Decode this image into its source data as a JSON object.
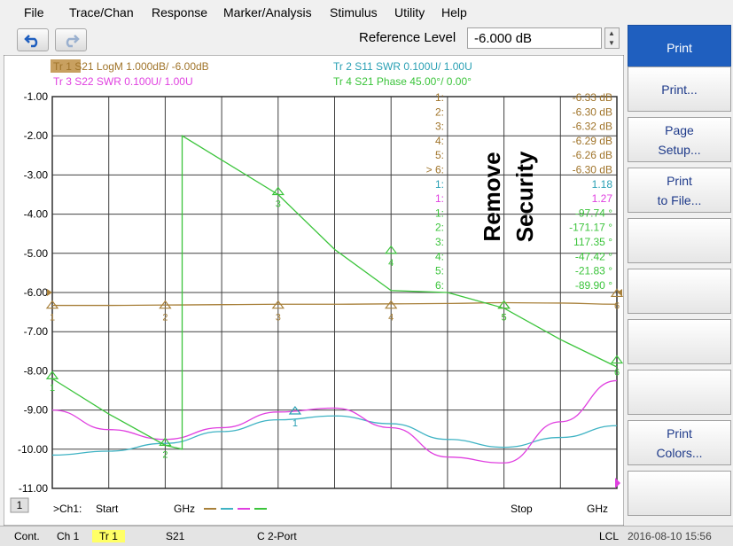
{
  "menu": [
    "File",
    "Trace/Chan",
    "Response",
    "Marker/Analysis",
    "Stimulus",
    "Utility",
    "Help"
  ],
  "reference": {
    "label": "Reference Level",
    "value": "-6.000 dB"
  },
  "softkeys": [
    {
      "label": "Print"
    },
    {
      "label": "Print..."
    },
    {
      "label": "Page\nSetup..."
    },
    {
      "label": "Print\nto File..."
    },
    {
      "label": ""
    },
    {
      "label": ""
    },
    {
      "label": ""
    },
    {
      "label": ""
    },
    {
      "label": "Print\nColors..."
    },
    {
      "label": ""
    }
  ],
  "chart_data": {
    "type": "line",
    "ylim": [
      -11,
      -1
    ],
    "y_ticks": [
      "-1.00",
      "-2.00",
      "-3.00",
      "-4.00",
      "-5.00",
      "-6.00",
      "-7.00",
      "-8.00",
      "-9.00",
      "-10.00",
      "-11.00"
    ],
    "grid": true,
    "x_points": 11,
    "trace_titles": [
      {
        "text": "Tr 1  S21 LogM 1.000dB/  -6.00dB",
        "color": "#a0742a"
      },
      {
        "text": "Tr 2  S11 SWR 0.100U/  1.00U",
        "color": "#2aa0b4"
      },
      {
        "text": "Tr 3  S22 SWR 0.100U/  1.00U",
        "color": "#e040e0"
      },
      {
        "text": "Tr 4  S21 Phase 45.00°/  0.00°",
        "color": "#3bc43b"
      }
    ],
    "series": [
      {
        "name": "S21 LogM",
        "color": "#a8803a",
        "values": [
          -6.33,
          -6.33,
          -6.32,
          -6.31,
          -6.3,
          -6.3,
          -6.29,
          -6.28,
          -6.26,
          -6.27,
          -6.3
        ]
      },
      {
        "name": "S11 SWR",
        "color": "#3fb3c4",
        "values": [
          -10.15,
          -10.05,
          -9.85,
          -9.55,
          -9.25,
          -9.15,
          -9.35,
          -9.75,
          -9.95,
          -9.7,
          -9.4
        ]
      },
      {
        "name": "S22 SWR",
        "color": "#e040e0",
        "values": [
          -9.0,
          -9.5,
          -9.75,
          -9.45,
          -9.05,
          -8.95,
          -9.45,
          -10.2,
          -10.35,
          -9.3,
          -8.25
        ]
      },
      {
        "name": "S21 Phase",
        "color": "#3bc43b",
        "values": [
          -8.2,
          -9.1,
          -9.9,
          -2.0,
          -3.5,
          -4.9,
          -5.95,
          -6.0,
          -6.4,
          -7.2,
          -7.9
        ]
      }
    ],
    "phase_jump": {
      "x": 2.3,
      "from": -10.0,
      "to": -2.0
    },
    "markers": [
      {
        "label": "1",
        "y": -6.4,
        "x": 0,
        "color": "#a8803a"
      },
      {
        "label": "2",
        "y": -6.4,
        "x": 2,
        "color": "#a8803a"
      },
      {
        "label": "3",
        "y": -6.4,
        "x": 4,
        "color": "#a8803a"
      },
      {
        "label": "4",
        "y": -6.4,
        "x": 6,
        "color": "#a8803a"
      },
      {
        "label": "5",
        "y": -6.4,
        "x": 8,
        "color": "#a8803a"
      },
      {
        "label": "6",
        "y": -6.1,
        "x": 10,
        "color": "#a8803a"
      },
      {
        "label": "1",
        "y": -8.2,
        "x": 0,
        "color": "#3bc43b"
      },
      {
        "label": "2",
        "y": -9.9,
        "x": 2,
        "color": "#3bc43b"
      },
      {
        "label": "3",
        "y": -3.5,
        "x": 4,
        "color": "#3bc43b"
      },
      {
        "label": "4",
        "y": -5.0,
        "x": 6,
        "color": "#3bc43b"
      },
      {
        "label": "5",
        "y": -6.4,
        "x": 8,
        "color": "#3bc43b"
      },
      {
        "label": "6",
        "y": -7.8,
        "x": 10,
        "color": "#3bc43b"
      },
      {
        "label": "1",
        "y": -9.1,
        "x": 4.3,
        "color": "#2aa0b4"
      }
    ],
    "marker_table": [
      {
        "id": "1:",
        "value": "-6.33 dB",
        "color": "#a0742a"
      },
      {
        "id": "2:",
        "value": "-6.30 dB",
        "color": "#a0742a"
      },
      {
        "id": "3:",
        "value": "-6.32 dB",
        "color": "#a0742a"
      },
      {
        "id": "4:",
        "value": "-6.29 dB",
        "color": "#a0742a"
      },
      {
        "id": "5:",
        "value": "-6.26 dB",
        "color": "#a0742a"
      },
      {
        "id": "> 6:",
        "value": "-6.30 dB",
        "color": "#a0742a"
      },
      {
        "id": "1:",
        "value": "1.18",
        "color": "#2aa0b4"
      },
      {
        "id": "1:",
        "value": "1.27",
        "color": "#e040e0"
      },
      {
        "id": "1:",
        "value": "-97.74 °",
        "color": "#3bc43b"
      },
      {
        "id": "2:",
        "value": "-171.17 °",
        "color": "#3bc43b"
      },
      {
        "id": "3:",
        "value": "117.35 °",
        "color": "#3bc43b"
      },
      {
        "id": "4:",
        "value": "-47.42 °",
        "color": "#3bc43b"
      },
      {
        "id": "5:",
        "value": "-21.83 °",
        "color": "#3bc43b"
      },
      {
        "id": "6:",
        "value": "-89.90 °",
        "color": "#3bc43b"
      }
    ],
    "overlay_text": [
      "Remove",
      "Security"
    ],
    "footer": {
      "channel_badge": "1",
      "ch_label": ">Ch1:",
      "start": "Start",
      "unit_left": "GHz",
      "stop": "Stop",
      "unit_right": "GHz"
    }
  },
  "status": {
    "cont": "Cont.",
    "ch": "Ch 1",
    "tr": "Tr 1",
    "param": "S21",
    "port": "C  2-Port",
    "lcl": "LCL",
    "datetime": "2016-08-10 15:56"
  }
}
